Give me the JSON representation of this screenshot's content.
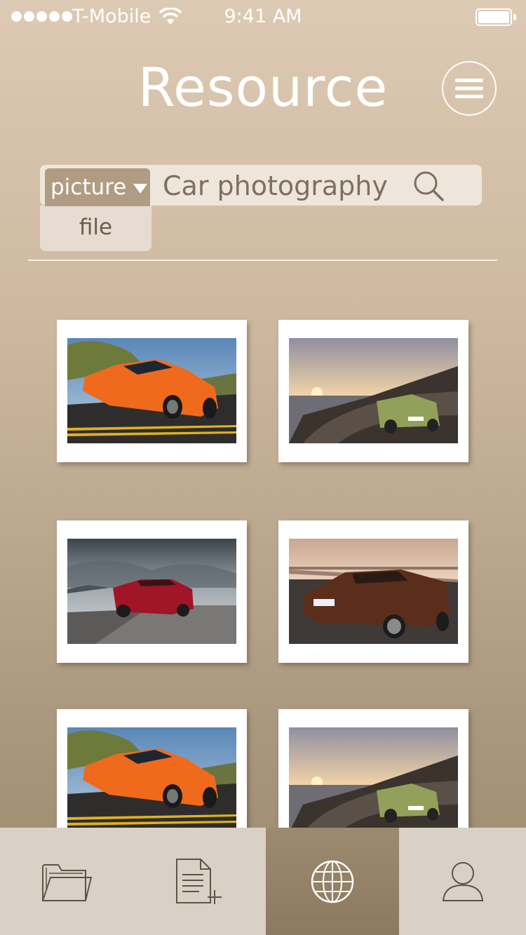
{
  "status_bar": {
    "carrier": "T-Mobile",
    "time": "9:41 AM",
    "signal_icon": "signal-dots-icon",
    "wifi_icon": "wifi-icon",
    "battery_icon": "battery-icon"
  },
  "header": {
    "title": "Resource",
    "menu_icon": "hamburger-menu-icon"
  },
  "search": {
    "type_selected": "picture",
    "type_options": [
      "file"
    ],
    "query": "Car photography",
    "search_icon": "magnifier-icon"
  },
  "photos": [
    {
      "subject": "orange sports car"
    },
    {
      "subject": "green SUV on coastal road at sunset"
    },
    {
      "subject": "red convertible"
    },
    {
      "subject": "brown convertible"
    },
    {
      "subject": "orange sports car"
    },
    {
      "subject": "green SUV on coastal road at sunset"
    }
  ],
  "tab_bar": {
    "tabs": [
      {
        "icon": "folder-icon",
        "active": false
      },
      {
        "icon": "new-document-icon",
        "active": false
      },
      {
        "icon": "globe-icon",
        "active": true
      },
      {
        "icon": "user-icon",
        "active": false
      }
    ]
  },
  "colors": {
    "background_top": "#ddcab4",
    "background_bottom": "#9a876c",
    "accent": "#b09c83",
    "active_tab": "#8c7a60",
    "tab_bar": "#d9d1c6"
  }
}
